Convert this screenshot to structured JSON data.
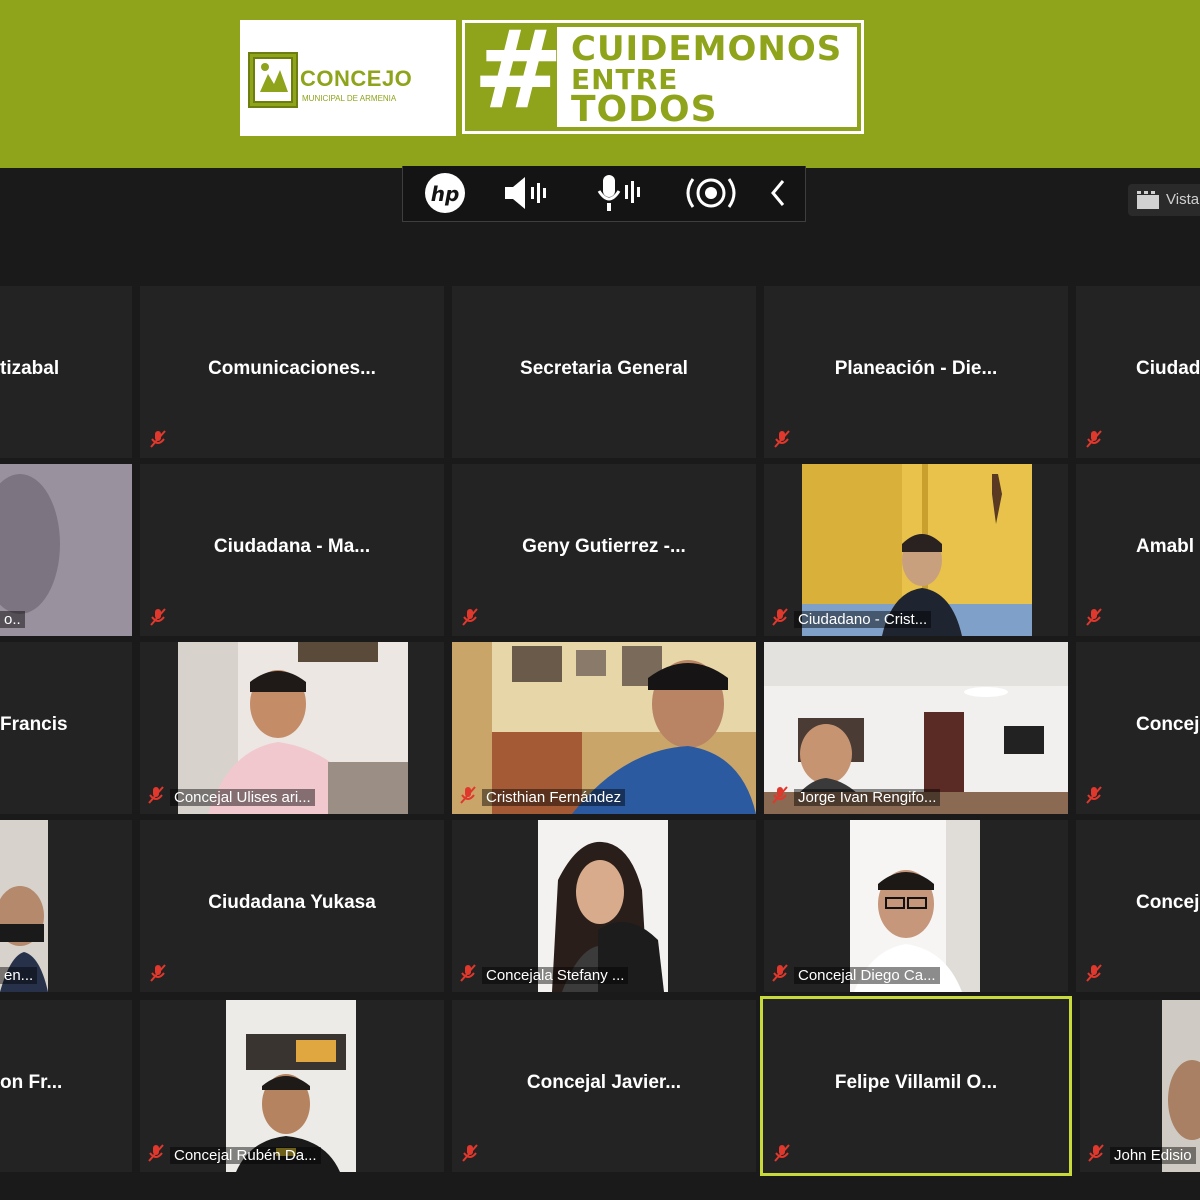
{
  "banner": {
    "logo_small_text": "ConcejoMuniciapal",
    "logo_name": "CONCEJO",
    "logo_sub": "MUNICIPAL DE ARMENIA",
    "hashtag": "#",
    "campaign_line1": "CUIDEMONOS",
    "campaign_line2": "ENTRE",
    "campaign_line3": "TODOS",
    "brand_color": "#8fa31b"
  },
  "toolbar": {
    "items": [
      "hp-logo-icon",
      "speaker-icon",
      "microphone-icon",
      "broadcast-icon",
      "chevron-left-icon"
    ],
    "view_label": "Vista"
  },
  "participants": [
    {
      "label": "tizabal",
      "video": false
    },
    {
      "label": "Comunicaciones...",
      "video": false
    },
    {
      "label": "Secretaria General",
      "video": false
    },
    {
      "label": "Planeación - Die...",
      "video": false
    },
    {
      "label": "Ciudad",
      "video": false
    },
    {
      "label": "o..",
      "video": true
    },
    {
      "label": "Ciudadana - Ma...",
      "video": false
    },
    {
      "label": "Geny Gutierrez -...",
      "video": false
    },
    {
      "label": "Ciudadano - Crist...",
      "video": true
    },
    {
      "label": "Amabl",
      "video": false
    },
    {
      "label": "Francis",
      "video": false
    },
    {
      "label": "Concejal Ulises ari...",
      "video": true
    },
    {
      "label": "Cristhian Fernández",
      "video": true
    },
    {
      "label": "Jorge Ivan Rengifo...",
      "video": true
    },
    {
      "label": "Concej",
      "video": false
    },
    {
      "label": "en...",
      "video": true
    },
    {
      "label": "Ciudadana Yukasa",
      "video": false
    },
    {
      "label": "Concejala Stefany ...",
      "video": true
    },
    {
      "label": "Concejal Diego Ca...",
      "video": true
    },
    {
      "label": "Concej",
      "video": false
    },
    {
      "label": "on Fr...",
      "video": false
    },
    {
      "label": "Concejal Rubén Da...",
      "video": true
    },
    {
      "label": "Concejal Javier...",
      "video": false
    },
    {
      "label": "Felipe Villamil O...",
      "video": false,
      "active": true
    },
    {
      "label": "John Edisio",
      "video": true
    }
  ],
  "colors": {
    "tile_bg": "#232323",
    "active_border": "#c8d93a",
    "mute_icon": "#e0382c"
  }
}
